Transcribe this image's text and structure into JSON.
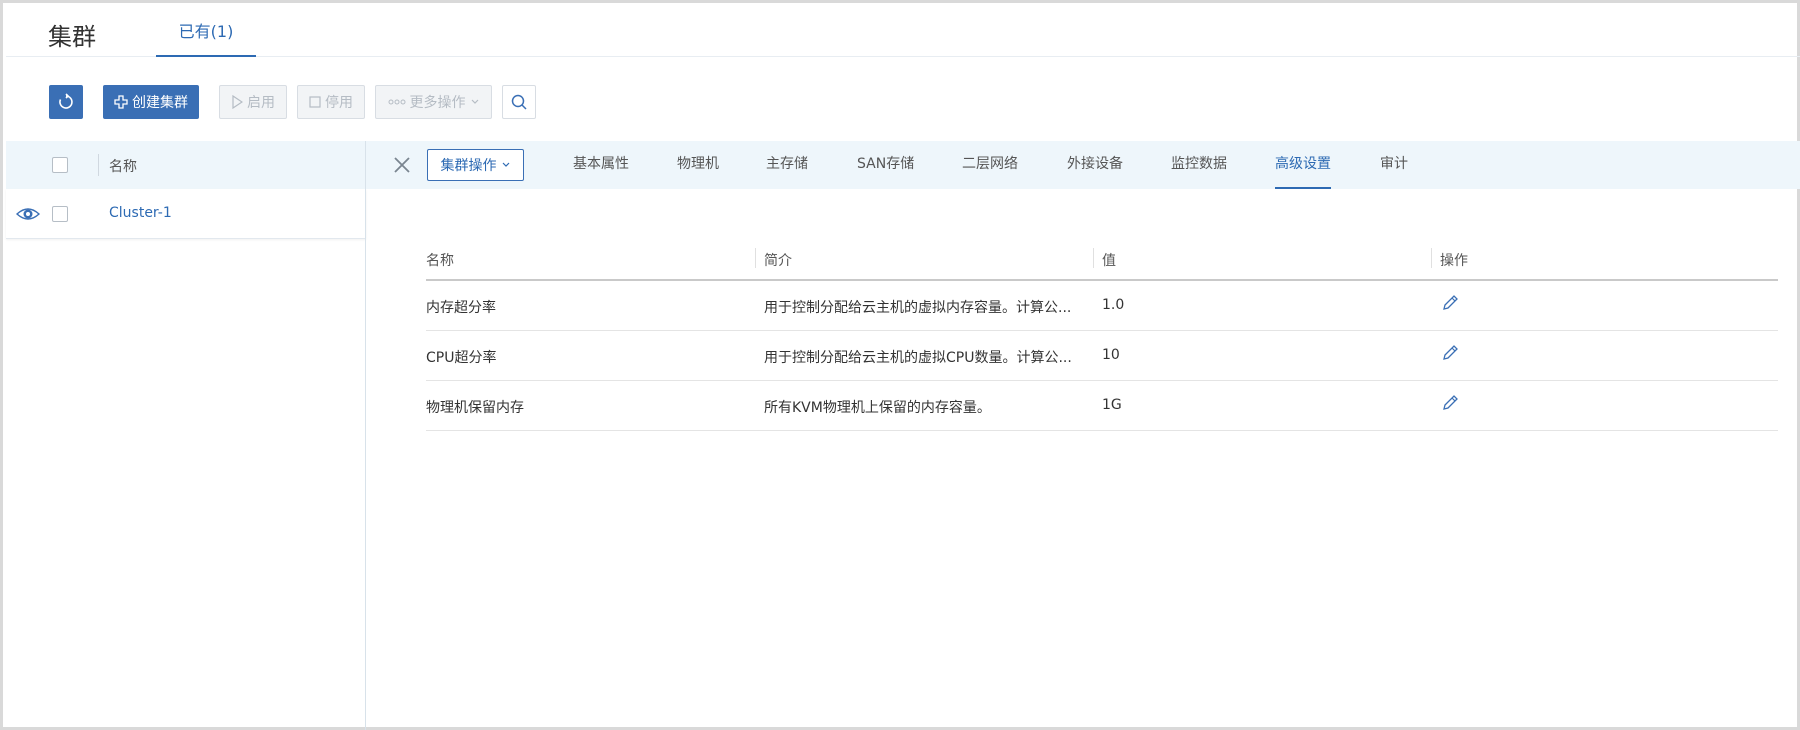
{
  "header": {
    "title": "集群",
    "tab_existing": "已有(1)"
  },
  "toolbar": {
    "create_label": "创建集群",
    "start_label": "启用",
    "stop_label": "停用",
    "more_label": "更多操作"
  },
  "list": {
    "header_name": "名称",
    "rows": [
      {
        "name": "Cluster-1"
      }
    ]
  },
  "detail": {
    "ops_label": "集群操作",
    "tabs": [
      {
        "label": "基本属性",
        "active": false
      },
      {
        "label": "物理机",
        "active": false
      },
      {
        "label": "主存储",
        "active": false
      },
      {
        "label": "SAN存储",
        "active": false
      },
      {
        "label": "二层网络",
        "active": false
      },
      {
        "label": "外接设备",
        "active": false
      },
      {
        "label": "监控数据",
        "active": false
      },
      {
        "label": "高级设置",
        "active": true
      },
      {
        "label": "审计",
        "active": false
      }
    ]
  },
  "settings_table": {
    "columns": [
      "名称",
      "简介",
      "值",
      "操作"
    ],
    "rows": [
      {
        "name": "内存超分率",
        "desc": "用于控制分配给云主机的虚拟内存容量。计算公...",
        "value": "1.0"
      },
      {
        "name": "CPU超分率",
        "desc": "用于控制分配给云主机的虚拟CPU数量。计算公...",
        "value": "10"
      },
      {
        "name": "物理机保留内存",
        "desc": "所有KVM物理机上保留的内存容量。",
        "value": "1G"
      }
    ]
  },
  "icons": {
    "refresh": "refresh-icon",
    "create": "plus-icon",
    "start": "play-icon",
    "stop": "stop-icon",
    "more": "more-dots-icon",
    "search": "search-icon",
    "view": "eye-icon",
    "close": "close-icon",
    "edit": "pencil-icon",
    "dropdown": "chevron-down-icon"
  },
  "colors": {
    "primary": "#3a6fb5",
    "link": "#2d6ab3",
    "header_bg": "#eef6fb",
    "disabled_bg": "#f2f4f6",
    "disabled_text": "#b5bcc4"
  }
}
